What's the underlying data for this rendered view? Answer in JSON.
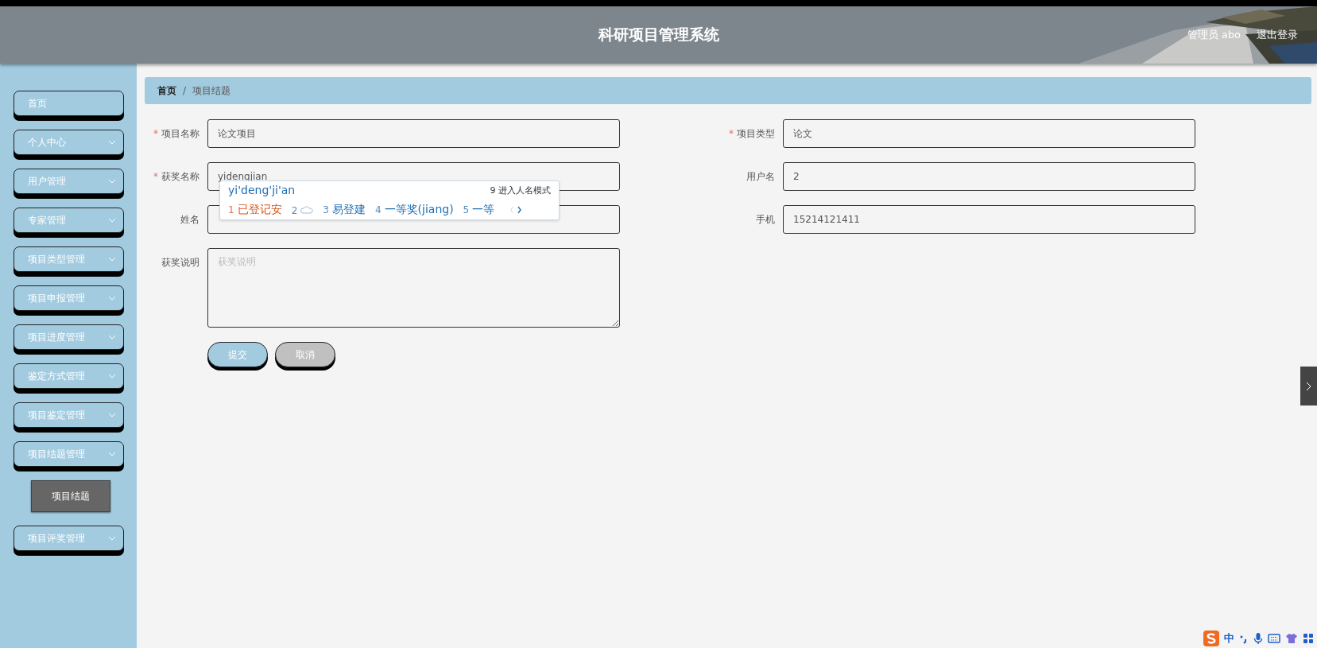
{
  "header": {
    "title": "科研项目管理系统",
    "user": "管理员 abo",
    "logout": "退出登录"
  },
  "sidebar": {
    "items": [
      {
        "label": "首页",
        "kind": "link"
      },
      {
        "label": "个人中心",
        "kind": "submenu"
      },
      {
        "label": "用户管理",
        "kind": "submenu"
      },
      {
        "label": "专家管理",
        "kind": "submenu"
      },
      {
        "label": "项目类型管理",
        "kind": "submenu"
      },
      {
        "label": "项目申报管理",
        "kind": "submenu"
      },
      {
        "label": "项目进度管理",
        "kind": "submenu"
      },
      {
        "label": "鉴定方式管理",
        "kind": "submenu"
      },
      {
        "label": "项目鉴定管理",
        "kind": "submenu"
      },
      {
        "label": "项目结题管理",
        "kind": "submenu",
        "children": [
          {
            "label": "项目结题",
            "selected": true
          }
        ]
      },
      {
        "label": "项目评奖管理",
        "kind": "submenu"
      }
    ]
  },
  "breadcrumb": [
    "首页",
    "项目结题"
  ],
  "breadcrumb_separator": "/",
  "form": {
    "required_mark": "*",
    "left": [
      {
        "label": "项目名称",
        "required": true,
        "kind": "input",
        "value": "论文项目"
      },
      {
        "label": "获奖名称",
        "required": true,
        "kind": "input",
        "value": "yidengjian"
      },
      {
        "label": "姓名",
        "required": false,
        "kind": "input"
      },
      {
        "label": "获奖说明",
        "required": false,
        "kind": "textarea",
        "placeholder": "获奖说明"
      }
    ],
    "right": [
      {
        "label": "项目类型",
        "required": true,
        "kind": "input",
        "value": "论文"
      },
      {
        "label": "用户名",
        "required": false,
        "kind": "input",
        "value": "2"
      },
      {
        "label": "手机",
        "required": false,
        "kind": "input",
        "value": "15214121411"
      }
    ],
    "buttons": [
      {
        "label": "提交",
        "kind": "primary"
      },
      {
        "label": "取消",
        "kind": "secondary"
      }
    ]
  },
  "ime": {
    "composition": "yi'deng'ji'an",
    "hint": "9 进入人名模式",
    "candidates": [
      {
        "index": "1",
        "kind": "text",
        "text": "已登记安",
        "selected": true
      },
      {
        "index": "2",
        "kind": "cloud",
        "selected": false
      },
      {
        "index": "3",
        "kind": "text",
        "text": "易登建",
        "selected": false
      },
      {
        "index": "4",
        "kind": "text",
        "text": "一等奖(jiang)",
        "selected": false
      },
      {
        "index": "5",
        "kind": "text",
        "text": "一等",
        "selected": false
      }
    ]
  },
  "ime_toolbar": {
    "mode": "中"
  }
}
